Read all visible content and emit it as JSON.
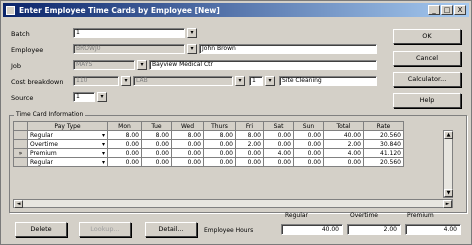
{
  "window": {
    "title": "Enter Employee Time Cards by Employee [New]",
    "controls": [
      "_",
      "□",
      "X"
    ]
  },
  "form": {
    "batch_label": "Batch",
    "batch_value": "1",
    "employee_label": "Employee",
    "employee_id": "BROWJ0",
    "employee_name": "John Brown",
    "job_label": "Job",
    "job_id": "MAYS",
    "job_name": "Bayview Medical Ctr",
    "cost_label": "Cost breakdown",
    "cost_a": "110",
    "cost_b": "LAB",
    "cost_c": "1",
    "cost_desc": "Site Cleaning",
    "source_label": "Source",
    "source_value": "1"
  },
  "side_buttons": {
    "ok": "OK",
    "cancel": "Cancel",
    "calculator": "Calculator...",
    "help": "Help"
  },
  "grid": {
    "group_title": "Time Card Information",
    "columns": [
      "Pay Type",
      "Mon",
      "Tue",
      "Wed",
      "Thurs",
      "Fri",
      "Sat",
      "Sun",
      "Total",
      "Rate"
    ],
    "rows": [
      {
        "marker": "",
        "pay_type": "Regular",
        "mon": "8.00",
        "tue": "8.00",
        "wed": "8.00",
        "thu": "8.00",
        "fri": "8.00",
        "sat": "0.00",
        "sun": "0.00",
        "total": "40.00",
        "rate": "20.560"
      },
      {
        "marker": "",
        "pay_type": "Overtime",
        "mon": "0.00",
        "tue": "0.00",
        "wed": "0.00",
        "thu": "0.00",
        "fri": "2.00",
        "sat": "0.00",
        "sun": "0.00",
        "total": "2.00",
        "rate": "30.840"
      },
      {
        "marker": "»",
        "pay_type": "Premium",
        "mon": "0.00",
        "tue": "0.00",
        "wed": "0.00",
        "thu": "0.00",
        "fri": "0.00",
        "sat": "4.00",
        "sun": "0.00",
        "total": "4.00",
        "rate": "41.120"
      },
      {
        "marker": "",
        "pay_type": "Regular",
        "mon": "0.00",
        "tue": "0.00",
        "wed": "0.00",
        "thu": "0.00",
        "fri": "0.00",
        "sat": "0.00",
        "sun": "0.00",
        "total": "0.00",
        "rate": "20.560"
      }
    ]
  },
  "bottom": {
    "delete": "Delete",
    "lookup": "Lookup...",
    "detail": "Detail...",
    "employee_hours_label": "Employee Hours",
    "regular_label": "Regular",
    "overtime_label": "Overtime",
    "premium_label": "Premium",
    "regular_value": "40.00",
    "overtime_value": "2.00",
    "premium_value": "4.00"
  }
}
